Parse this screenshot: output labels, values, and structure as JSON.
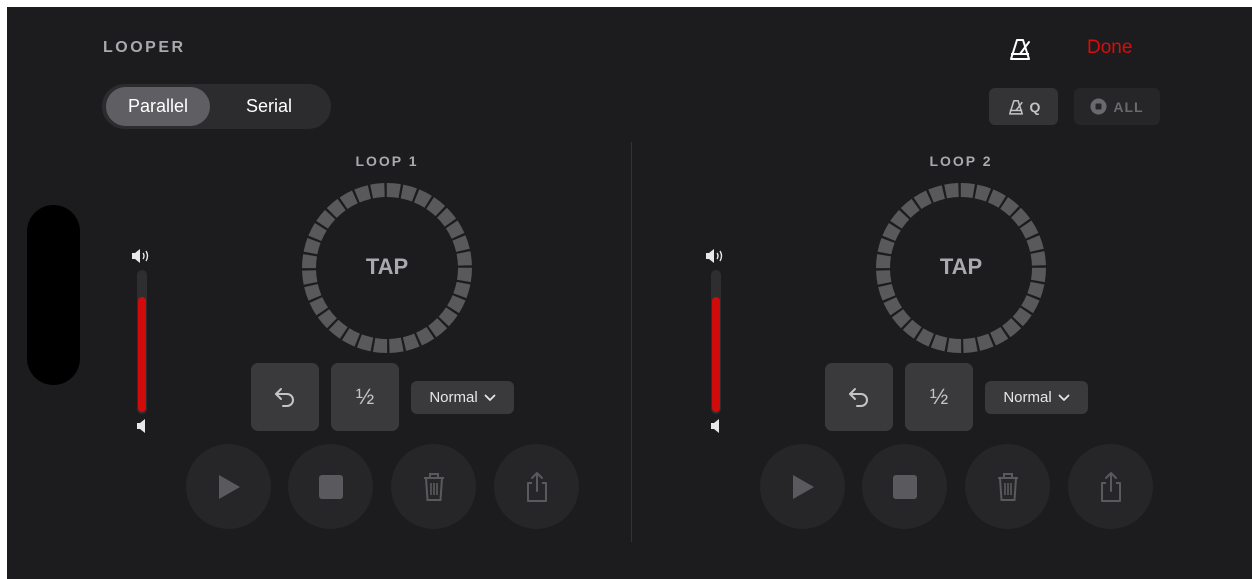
{
  "header": {
    "title": "LOOPER",
    "done_label": "Done"
  },
  "mode_toggle": {
    "options": [
      "Parallel",
      "Serial"
    ],
    "selected": "Parallel"
  },
  "toolbar": {
    "quantize_label": "Q",
    "stop_all_label": "ALL"
  },
  "loops": [
    {
      "label": "LOOP 1",
      "tap_label": "TAP",
      "half_label": "½",
      "speed_label": "Normal",
      "volume_level": 0.8
    },
    {
      "label": "LOOP 2",
      "tap_label": "TAP",
      "half_label": "½",
      "speed_label": "Normal",
      "volume_level": 0.8
    }
  ],
  "icons": {
    "metronome": "metronome-icon",
    "undo": "undo-icon",
    "chevron": "chevron-down-icon",
    "play": "play-icon",
    "stop": "stop-icon",
    "trash": "trash-icon",
    "share": "share-icon",
    "speaker_high": "speaker-high-icon",
    "speaker_low": "speaker-low-icon"
  },
  "colors": {
    "background": "#1c1c1e",
    "accent_red": "#d70d0d",
    "meter_red": "#d10b0b",
    "ring": "#59595c"
  }
}
